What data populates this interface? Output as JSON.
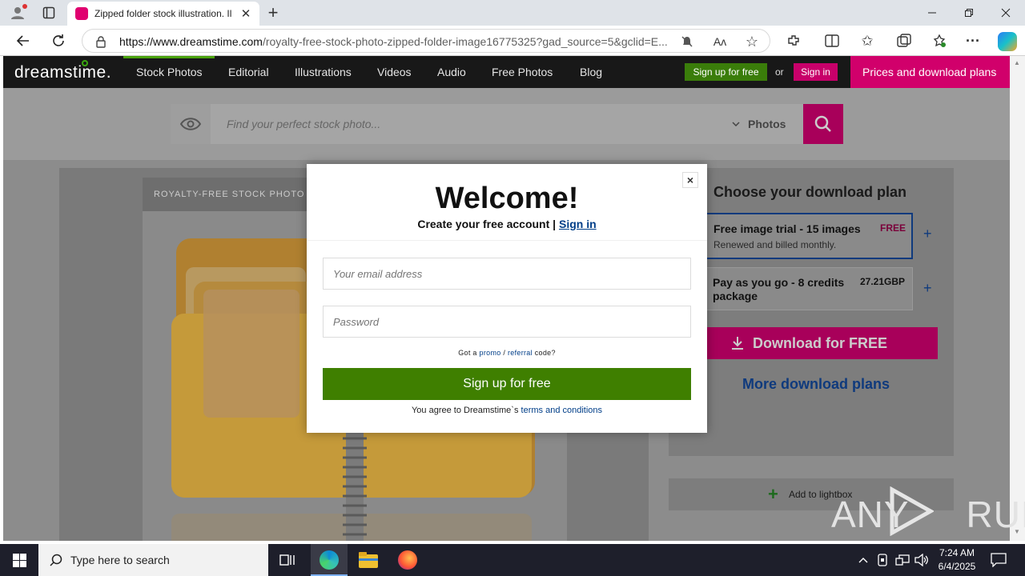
{
  "browser": {
    "tab_title": "Zipped folder stock illustration. Il",
    "url_host": "https://www.dreamstime.com",
    "url_path": "/royalty-free-stock-photo-zipped-folder-image16775325?gad_source=5&gclid=E..."
  },
  "site": {
    "logo": "dreamstime.",
    "nav": [
      "Stock Photos",
      "Editorial",
      "Illustrations",
      "Videos",
      "Audio",
      "Free Photos",
      "Blog"
    ],
    "signup_label": "Sign up for free",
    "or_label": "or",
    "signin_label": "Sign in",
    "prices_label": "Prices and download plans",
    "search_placeholder": "Find your perfect stock photo...",
    "search_type": "Photos"
  },
  "content": {
    "badge": "ROYALTY-FREE STOCK PHOTO",
    "plan_heading": "Choose your download plan",
    "plans": [
      {
        "title": "Free image trial - 15 images",
        "sub": "Renewed and billed monthly.",
        "price": "FREE"
      },
      {
        "title": "Pay as you go - 8 credits package",
        "sub": "",
        "price": "27.21GBP"
      }
    ],
    "download_label": "Download for FREE",
    "more_plans": "More download plans",
    "lightbox": "Add to lightbox"
  },
  "modal": {
    "title": "Welcome!",
    "subtitle": "Create your free account |",
    "signin_link": "Sign in",
    "email_placeholder": "Your email address",
    "password_placeholder": "Password",
    "promo_prefix": "Got a",
    "promo_link": "promo",
    "slash": "/",
    "referral_link": "referral",
    "promo_suffix": "code?",
    "submit": "Sign up for free",
    "terms_prefix": "You agree to Dreamstime`s",
    "terms_link": "terms and conditions",
    "close": "×"
  },
  "watermark": "ANY RUN",
  "taskbar": {
    "search_placeholder": "Type here to search",
    "time": "7:24 AM",
    "date": "6/4/2025"
  },
  "colors": {
    "brand_pink": "#d1006b",
    "brand_green": "#3f7f00",
    "link_blue": "#003e88"
  }
}
